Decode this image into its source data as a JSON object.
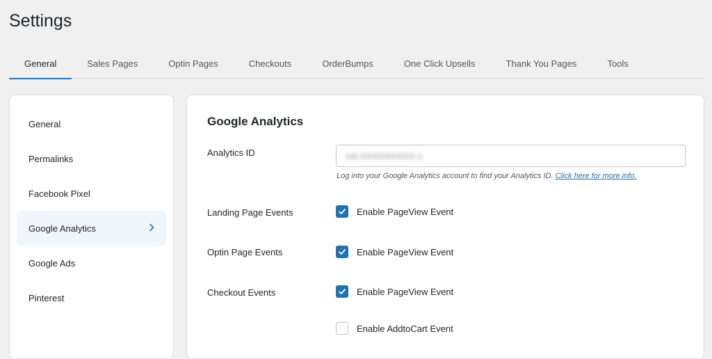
{
  "page": {
    "title": "Settings"
  },
  "tabs": [
    {
      "label": "General",
      "active": true
    },
    {
      "label": "Sales Pages"
    },
    {
      "label": "Optin Pages"
    },
    {
      "label": "Checkouts"
    },
    {
      "label": "OrderBumps"
    },
    {
      "label": "One Click Upsells"
    },
    {
      "label": "Thank You Pages"
    },
    {
      "label": "Tools"
    }
  ],
  "sidebar": {
    "items": [
      {
        "label": "General"
      },
      {
        "label": "Permalinks"
      },
      {
        "label": "Facebook Pixel"
      },
      {
        "label": "Google Analytics",
        "active": true
      },
      {
        "label": "Google Ads"
      },
      {
        "label": "Pinterest"
      }
    ]
  },
  "panel": {
    "title": "Google Analytics",
    "analytics_id": {
      "label": "Analytics ID",
      "value": "UA-XXXXXXXXX-1",
      "help_text": "Log into your Google Analytics account to find your Analytics ID.",
      "help_link": "Click here for more info."
    },
    "landing": {
      "label": "Landing Page Events",
      "option": "Enable PageView Event",
      "checked": true
    },
    "optin": {
      "label": "Optin Page Events",
      "option": "Enable PageView Event",
      "checked": true
    },
    "checkout": {
      "label": "Checkout Events",
      "options": [
        {
          "label": "Enable PageView Event",
          "checked": true
        },
        {
          "label": "Enable AddtoCart Event",
          "checked": false
        }
      ]
    }
  },
  "colors": {
    "accent": "#2271b1",
    "active_bg": "#f0f6fc"
  }
}
